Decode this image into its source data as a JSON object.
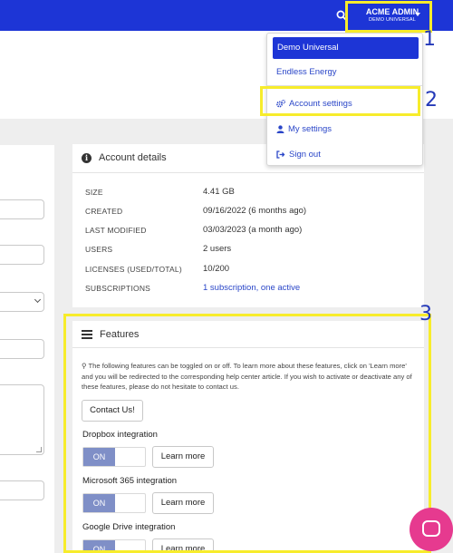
{
  "header": {
    "user_name": "ACME ADMIN",
    "user_org": "DEMO UNIVERSAL",
    "brand_color": "#1d35d6"
  },
  "dropdown": {
    "items": [
      {
        "label": "Demo Universal",
        "selected": true
      },
      {
        "label": "Endless Energy"
      },
      {
        "label": "Account settings",
        "icon": "gears-icon"
      },
      {
        "label": "My settings",
        "icon": "user-icon"
      },
      {
        "label": "Sign out",
        "icon": "sign-out-icon"
      }
    ]
  },
  "account_details": {
    "title": "Account details",
    "rows": [
      {
        "label": "SIZE",
        "value": "4.41 GB"
      },
      {
        "label": "CREATED",
        "value": "09/16/2022 (6 months ago)"
      },
      {
        "label": "LAST MODIFIED",
        "value": "03/03/2023 (a month ago)"
      },
      {
        "label": "USERS",
        "value": "2 users"
      },
      {
        "label": "LICENSES (USED/TOTAL)",
        "value": "10/200"
      },
      {
        "label": "SUBSCRIPTIONS",
        "value": "1 subscription, one active"
      }
    ]
  },
  "features": {
    "title": "Features",
    "description": "The following features can be toggled on or off. To learn more about these features, click on 'Learn more' and you will be redirected to the corresponding help center article. If you wish to activate or deactivate any of these features, please do not hesitate to contact us.",
    "contact_label": "Contact Us!",
    "integrations": [
      {
        "label": "Dropbox integration",
        "toggle": "ON",
        "learn": "Learn more"
      },
      {
        "label": "Microsoft 365 integration",
        "toggle": "ON",
        "learn": "Learn more"
      },
      {
        "label": "Google Drive integration",
        "toggle": "ON",
        "learn": "Learn more"
      }
    ]
  },
  "callouts": {
    "one": "1",
    "two": "2",
    "three": "3",
    "highlight_color": "#f7ec2b"
  }
}
